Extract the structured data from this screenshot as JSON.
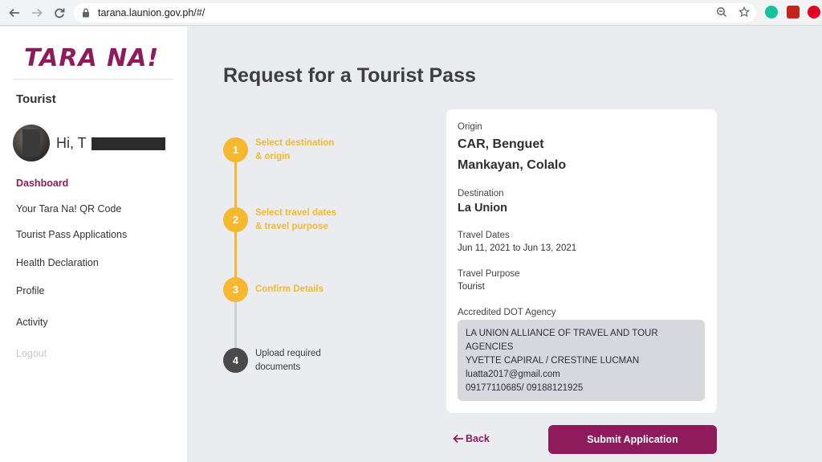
{
  "browser": {
    "url": "tarana.launion.gov.ph/#/"
  },
  "sidebar": {
    "logo": "TARA NA!",
    "role": "Tourist",
    "greeting": "Hi, T",
    "items": [
      {
        "label": "Dashboard"
      },
      {
        "label": "Your Tara Na! QR Code"
      },
      {
        "label": "Tourist Pass Applications"
      },
      {
        "label": "Health Declaration"
      },
      {
        "label": "Profile"
      },
      {
        "label": "Activity"
      },
      {
        "label": "Logout"
      }
    ]
  },
  "main": {
    "title": "Request for a Tourist Pass",
    "steps": [
      {
        "number": "1",
        "line1": "Select destination",
        "line2": "& origin",
        "status": "done"
      },
      {
        "number": "2",
        "line1": "Select travel dates",
        "line2": "& travel purpose",
        "status": "done"
      },
      {
        "number": "3",
        "line1": "Confirm Details",
        "line2": "",
        "status": "current"
      },
      {
        "number": "4",
        "line1": "Upload required",
        "line2": "documents",
        "status": "todo"
      }
    ],
    "details": {
      "origin_label": "Origin",
      "origin_line1": "CAR, Benguet",
      "origin_line2": "Mankayan, Colalo",
      "destination_label": "Destination",
      "destination_value": "La Union",
      "dates_label": "Travel Dates",
      "dates_value": "Jun 11, 2021 to Jun 13, 2021",
      "purpose_label": "Travel Purpose",
      "purpose_value": "Tourist",
      "agency_label": "Accredited DOT Agency",
      "agency_lines": [
        "LA UNION ALLIANCE OF TRAVEL AND TOUR",
        "AGENCIES",
        "YVETTE CAPIRAL / CRESTINE LUCMAN",
        "luatta2017@gmail.com",
        "09177110685/ 09188121925"
      ]
    },
    "back_label": "Back",
    "submit_label": "Submit Application"
  },
  "colors": {
    "brand": "#8e1b5c",
    "step_done": "#f5b82e",
    "step_todo": "#4a4a4a",
    "page_bg": "#ebecf0"
  }
}
